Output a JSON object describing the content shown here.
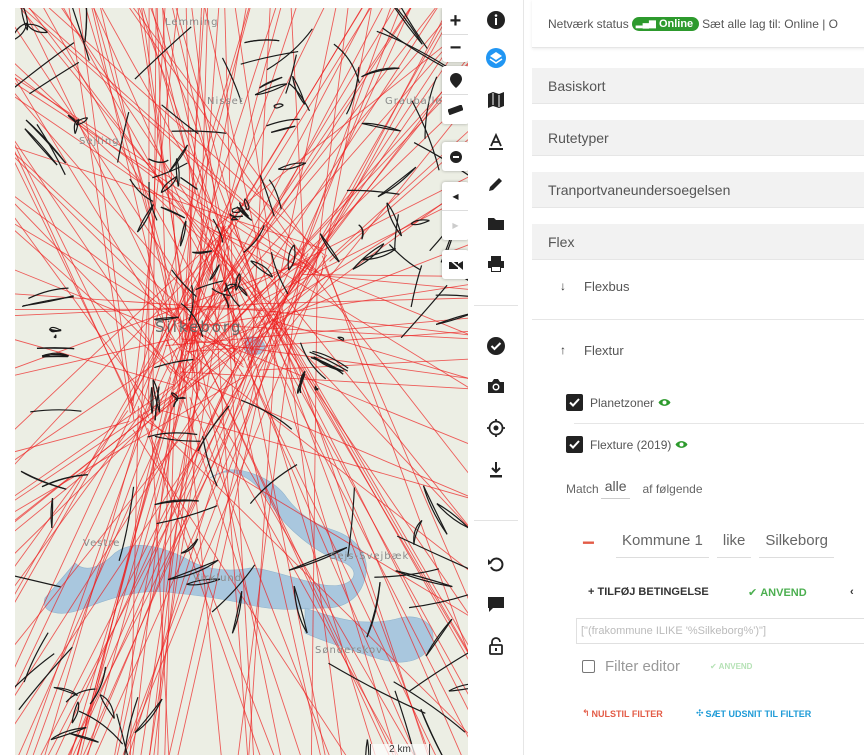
{
  "map": {
    "places": [
      "Lemming",
      "Nisset",
      "Grauballe",
      "Sejling",
      "Silkeborg",
      "Vestre",
      "Virklund",
      "Sejs-Svejbæk",
      "Sønderskov"
    ],
    "scale_label": "2 km",
    "zoom_in": "+",
    "zoom_out": "−"
  },
  "status": {
    "label": "Netværk status",
    "badge": "Online",
    "tail": "Sæt alle lag til: Online | O"
  },
  "groups": {
    "basiskort": "Basiskort",
    "rutetyper": "Rutetyper",
    "transport": "Tranportvaneundersoegelsen",
    "flex": "Flex"
  },
  "flex": {
    "flexbus": "Flexbus",
    "flextur": "Flextur",
    "layers": [
      "Planetzoner",
      "Flexture (2019)"
    ]
  },
  "filter": {
    "match_prefix": "Match",
    "match_value": "alle",
    "match_suffix": "af følgende",
    "condition": {
      "field": "Kommune 1",
      "operator": "like",
      "value": "Silkeborg"
    },
    "add_condition": "+ TILFØJ BETINGELSE",
    "apply": "ANVEND",
    "expression_placeholder": "[\"(frakommune ILIKE '%Silkeborg%')\"]",
    "filter_editor_label": "Filter editor",
    "apply_small": "ANVEND",
    "reset": "NULSTIL FILTER",
    "set_extent": "SÆT UDSNIT TIL FILTER"
  },
  "colors": {
    "accent_blue": "#2196f3",
    "online_green": "#2d9a2d",
    "apply_green": "#4caf50",
    "reset_red": "#e35c47",
    "route_red": "#ee1c1c",
    "extent_blue": "#1e9bd7"
  },
  "icons": {
    "toolbar": [
      "info-icon",
      "layers-icon",
      "map-icon",
      "text-icon",
      "pencil-icon",
      "folder-icon",
      "print-icon",
      "check-circle-icon",
      "camera-icon",
      "locate-icon",
      "download-icon",
      "undo-icon",
      "comment-icon",
      "unlock-icon"
    ]
  }
}
